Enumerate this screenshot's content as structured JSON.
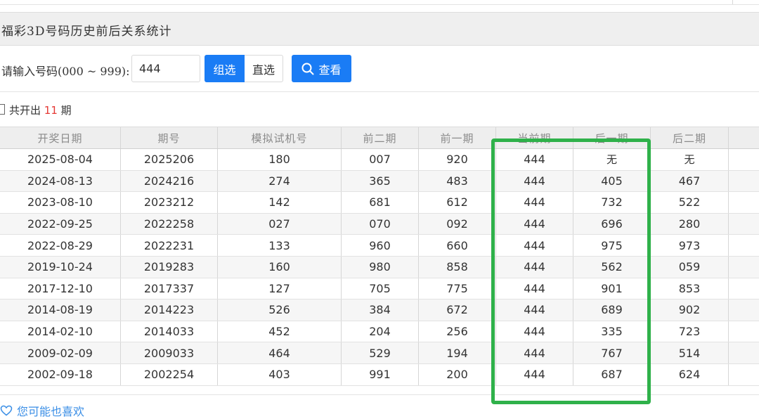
{
  "title": "福彩3D号码历史前后关系统计",
  "query": {
    "label": "请输入号码(000 ~ 999):",
    "value": "444",
    "mode_group": "组选",
    "mode_direct": "直选",
    "search_label": "查看"
  },
  "summary": {
    "prefix": "共开出",
    "count": "11",
    "suffix": "期"
  },
  "table": {
    "headers": [
      "开奖日期",
      "期号",
      "模拟试机号",
      "前二期",
      "前一期",
      "当前期",
      "后一期",
      "后二期"
    ],
    "rows": [
      [
        "2025-08-04",
        "2025206",
        "180",
        "007",
        "920",
        "444",
        "无",
        "无"
      ],
      [
        "2024-08-13",
        "2024216",
        "274",
        "365",
        "483",
        "444",
        "405",
        "467"
      ],
      [
        "2023-08-10",
        "2023212",
        "142",
        "681",
        "612",
        "444",
        "732",
        "522"
      ],
      [
        "2022-09-25",
        "2022258",
        "027",
        "070",
        "092",
        "444",
        "696",
        "280"
      ],
      [
        "2022-08-29",
        "2022231",
        "133",
        "960",
        "660",
        "444",
        "975",
        "973"
      ],
      [
        "2019-10-24",
        "2019283",
        "160",
        "980",
        "858",
        "444",
        "562",
        "059"
      ],
      [
        "2017-12-10",
        "2017337",
        "127",
        "705",
        "775",
        "444",
        "901",
        "853"
      ],
      [
        "2014-08-19",
        "2014223",
        "526",
        "384",
        "672",
        "444",
        "689",
        "902"
      ],
      [
        "2014-02-10",
        "2014033",
        "452",
        "204",
        "256",
        "444",
        "335",
        "723"
      ],
      [
        "2009-02-09",
        "2009033",
        "464",
        "529",
        "194",
        "444",
        "767",
        "514"
      ],
      [
        "2002-09-18",
        "2002254",
        "403",
        "991",
        "200",
        "444",
        "687",
        "624"
      ]
    ]
  },
  "footer": {
    "favorites_label": "您可能也喜欢",
    "icon": "heart-icon"
  },
  "colors": {
    "primary": "#1a7cf5",
    "highlight": "#2fb14a",
    "count": "#e53935",
    "link": "#3a8ee6"
  }
}
